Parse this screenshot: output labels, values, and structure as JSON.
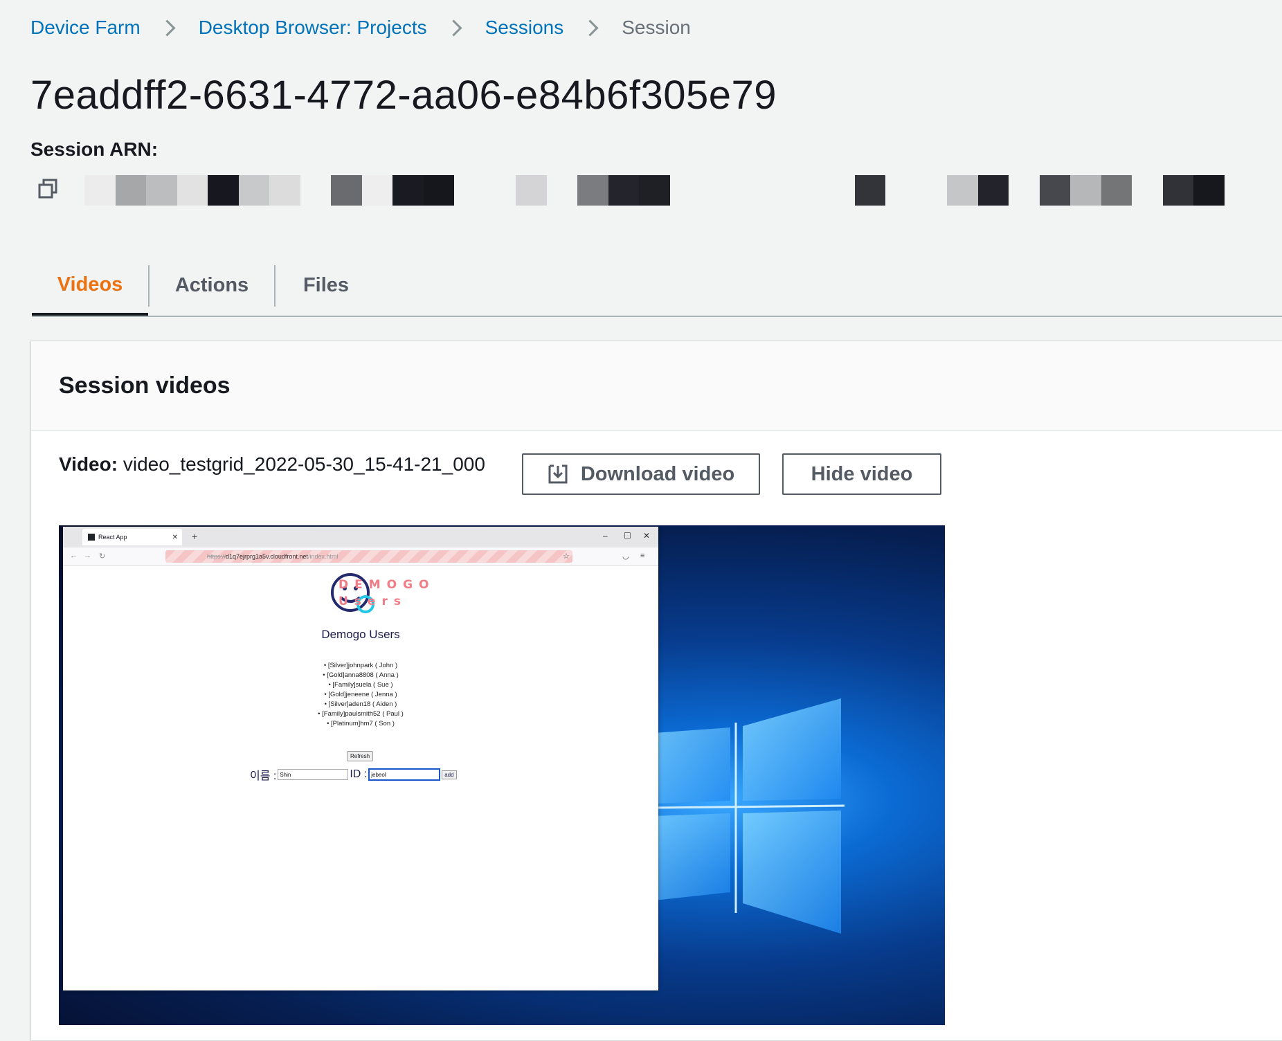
{
  "breadcrumb": {
    "items": [
      "Device Farm",
      "Desktop Browser: Projects",
      "Sessions"
    ],
    "current": "Session"
  },
  "page_title": "7eaddff2-6631-4772-aa06-e84b6f305e79",
  "arn": {
    "label": "Session ARN:",
    "copy_icon": "copy-icon",
    "value_redacted": true,
    "redaction_colors": [
      "#ececec",
      "#a6a7a9",
      "#bcbdbe",
      "#e2e2e2",
      "#17181f",
      "#c8c9ca",
      "#dcdcdc",
      "#6a6b6e",
      "#eeeeee",
      "#1a1b22",
      "#16171d",
      "#d4d4d6",
      "#7b7c7f",
      "#24252c",
      "#1f2026",
      "#32343a",
      "#c5c6c8",
      "#23242b",
      "#46484d",
      "#b6b7b9",
      "#747577",
      "#313238",
      "#17181e"
    ]
  },
  "tabs": [
    {
      "label": "Videos",
      "active": true
    },
    {
      "label": "Actions",
      "active": false
    },
    {
      "label": "Files",
      "active": false
    }
  ],
  "panel": {
    "title": "Session videos",
    "video_label": "Video:",
    "video_name": "video_testgrid_2022-05-30_15-41-21_000",
    "download_label": "Download video",
    "hide_label": "Hide video"
  },
  "video_frame": {
    "browser": {
      "tab_title": "React App",
      "url_prefix": "https://",
      "url_host": "d1q7ejrprg1a5v.cloudfront.net",
      "url_path": "/index.html"
    },
    "app": {
      "logo_line1": "DEMOGO",
      "logo_line2": "Users",
      "title": "Demogo Users",
      "users": [
        "[Silver]johnpark ( John )",
        "[Gold]anna8808 ( Anna )",
        "[Family]suela ( Sue )",
        "[Gold]jeneene ( Jenna )",
        "[Silver]aden18 ( Aiden )",
        "[Family]paulsmith52 ( Paul )",
        "[Platinum]hm7 ( Son )"
      ],
      "refresh_label": "Refresh",
      "name_label": "이름 :",
      "name_value": "Shin",
      "id_label": "ID :",
      "id_value": "jebeol",
      "add_label": "add"
    }
  },
  "colors": {
    "link": "#0073bb",
    "active_tab": "#ec7211",
    "background": "#f2f3f3"
  }
}
